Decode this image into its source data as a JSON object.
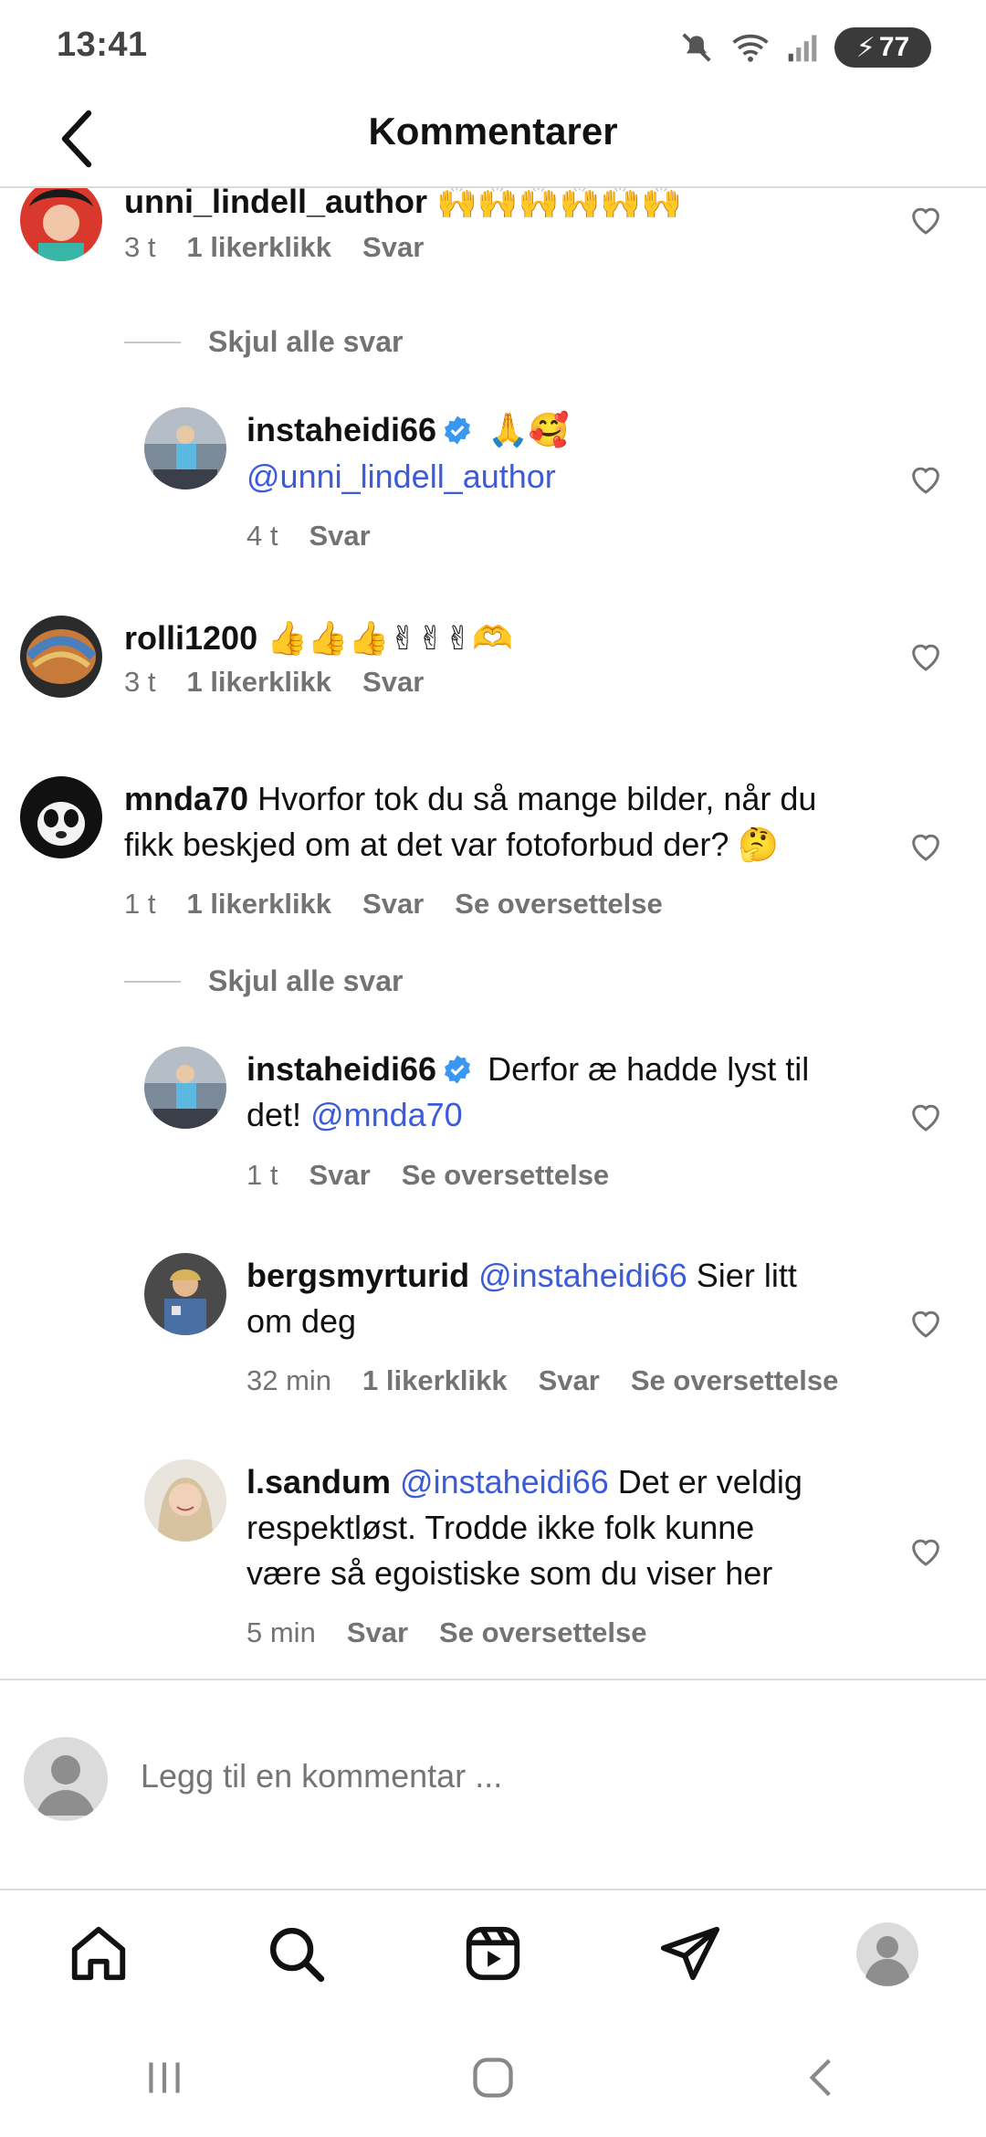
{
  "status": {
    "time": "13:41",
    "battery": "77"
  },
  "header": {
    "title": "Kommentarer"
  },
  "comments": [
    {
      "username": "unni_lindell_author",
      "text": "",
      "emoji": "🙌🙌🙌🙌🙌🙌",
      "time": "3 t",
      "likes": "1 likerklikk",
      "reply": "Svar"
    },
    {
      "toggle": "Skjul alle svar"
    },
    {
      "username": "instaheidi66",
      "emoji": "🙏🥰",
      "mention": "@unni_lindell_author",
      "time": "4 t",
      "reply": "Svar"
    },
    {
      "username": "rolli1200",
      "emoji": "👍👍👍✌✌✌🫶",
      "time": "3 t",
      "likes": "1 likerklikk",
      "reply": "Svar"
    },
    {
      "username": "mnda70",
      "text_line1": "Hvorfor tok du så mange bilder, når du",
      "text_line2": "fikk beskjed om at det var fotoforbud der?",
      "emoji": "🤔",
      "time": "1 t",
      "likes": "1 likerklikk",
      "reply": "Svar",
      "translate": "Se oversettelse"
    },
    {
      "toggle": "Skjul alle svar"
    },
    {
      "username": "instaheidi66",
      "text_line1": "Derfor æ hadde lyst til",
      "text_line2": "det!",
      "mention": "@mnda70",
      "time": "1 t",
      "reply": "Svar",
      "translate": "Se oversettelse"
    },
    {
      "username": "bergsmyrturid",
      "mention": "@instaheidi66",
      "text_line1": "Sier litt",
      "text_line2": "om deg",
      "time": "32 min",
      "likes": "1 likerklikk",
      "reply": "Svar",
      "translate": "Se oversettelse"
    },
    {
      "username": "l.sandum",
      "mention": "@instaheidi66",
      "text_line1": "Det er veldig",
      "text_line2": "respektløst. Trodde ikke folk kunne",
      "text_line3": "være så egoistiske som du viser her",
      "time": "5 min",
      "reply": "Svar",
      "translate": "Se oversettelse"
    }
  ],
  "composer": {
    "placeholder": "Legg til en kommentar ..."
  },
  "colors": {
    "accent": "#3b5bdb",
    "verified": "#3897f0",
    "muted": "#737373"
  },
  "icons": [
    "back-arrow-icon",
    "heart-icon",
    "verified-badge-icon",
    "home-icon",
    "search-icon",
    "reels-icon",
    "send-icon",
    "profile-icon"
  ]
}
